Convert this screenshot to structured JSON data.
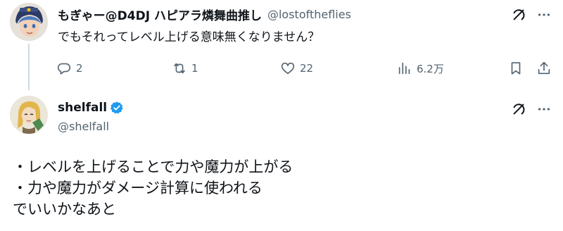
{
  "reply_tweet": {
    "display_name": "もぎゃー@D4DJ ハピアラ燐舞曲推し",
    "handle": "@lostoftheflies",
    "text": "でもそれってレベル上げる意味無くなりません？",
    "reply_count": "2",
    "retweet_count": "1",
    "like_count": "22",
    "view_count": "6.2万"
  },
  "main_tweet": {
    "display_name": "shelfall",
    "handle": "@shelfall",
    "lines": [
      "・レベルを上げることで力や魔力が上がる",
      "・力や魔力がダメージ計算に使われる",
      "でいいかなあと"
    ]
  },
  "colors": {
    "text_primary": "#0f1419",
    "text_secondary": "#536471",
    "verified_blue": "#1d9bf0",
    "thread_line": "#cfd9de"
  },
  "icons": [
    "reply-icon",
    "retweet-icon",
    "like-icon",
    "views-icon",
    "bookmark-icon",
    "share-icon",
    "grok-icon",
    "more-icon",
    "verified-badge-icon"
  ]
}
